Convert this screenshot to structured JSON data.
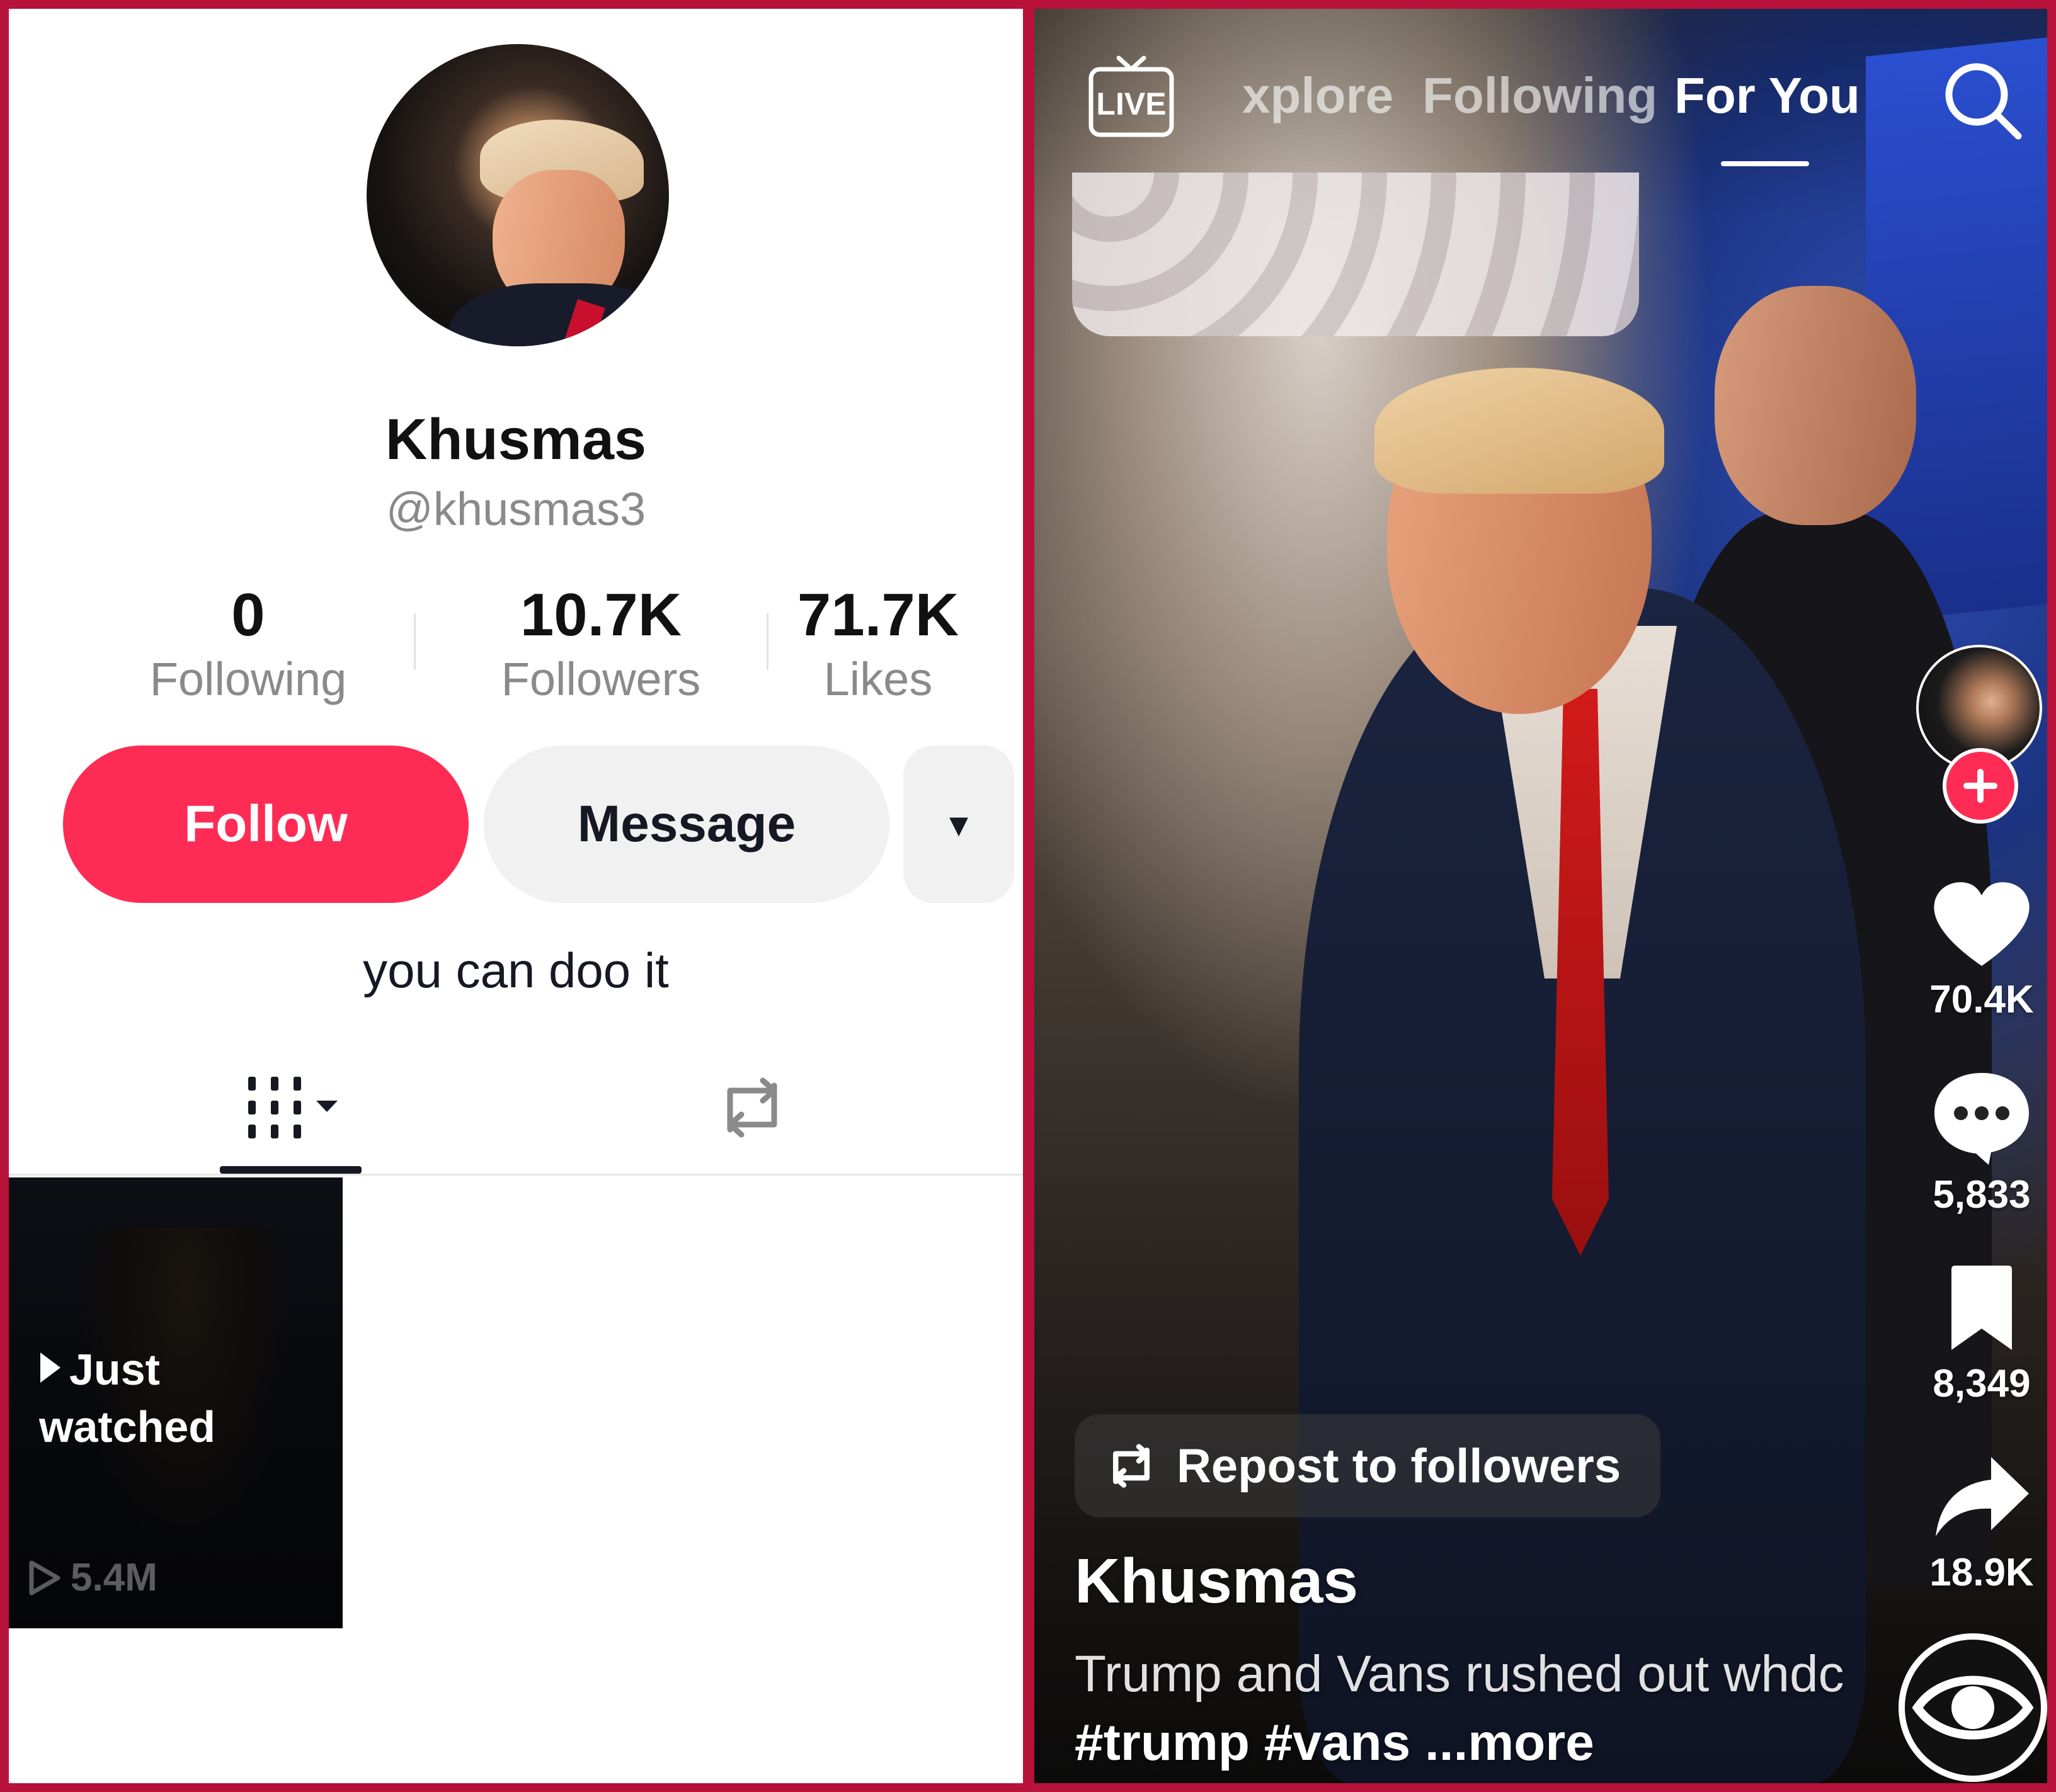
{
  "profile": {
    "username": "Khusmas",
    "handle": "@khusmas3",
    "stats": [
      {
        "value": "0",
        "label": "Following"
      },
      {
        "value": "10.7K",
        "label": "Followers"
      },
      {
        "value": "71.7K",
        "label": "Likes"
      }
    ],
    "follow_label": "Follow",
    "message_label": "Message",
    "more_glyph": "▾",
    "bio": "you can doo it",
    "videos": [
      {
        "overlay_line1": "Just",
        "overlay_line2": "watched",
        "views": "5.4M"
      }
    ]
  },
  "feed": {
    "live_label": "LIVE",
    "tabs": [
      {
        "label": "xplore",
        "active": false
      },
      {
        "label": "Following",
        "active": false
      },
      {
        "label": "For You",
        "active": true
      }
    ],
    "actions": {
      "likes": "70.4K",
      "comments": "5,833",
      "saves": "8,349",
      "shares": "18.9K"
    },
    "repost_label": "Repost to followers",
    "author": "Khusmas",
    "caption_text": "Trump and Vans rushed out whdc",
    "caption_tags": "#trump #vans",
    "caption_more": "...more"
  },
  "colors": {
    "accent": "#fe2c55",
    "frame": "#b8123a",
    "secondary_text": "#8a8a8a",
    "button_gray": "#f1f1f2"
  },
  "icons": [
    "live-icon",
    "search-icon",
    "heart-icon",
    "comment-icon",
    "bookmark-icon",
    "share-icon",
    "repost-icon",
    "grid-icon",
    "play-icon",
    "plus-icon"
  ]
}
